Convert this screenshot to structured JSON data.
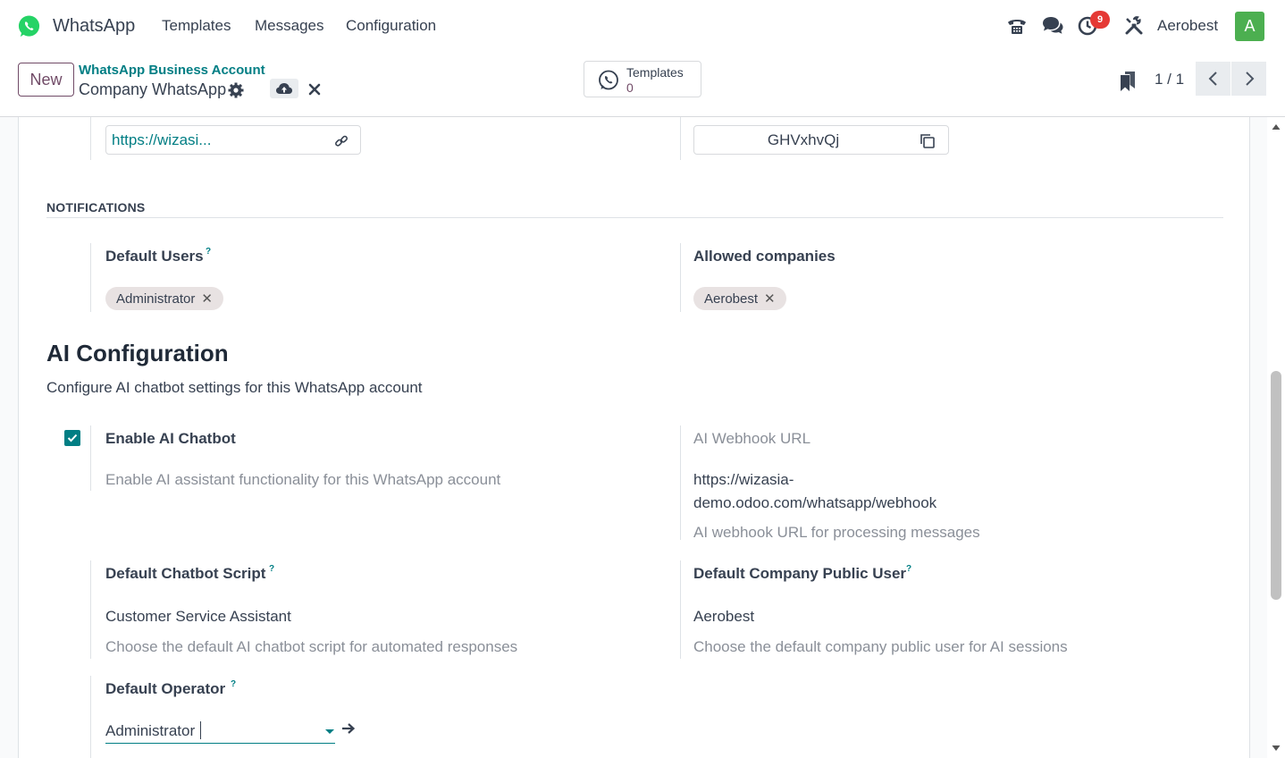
{
  "navbar": {
    "app_name": "WhatsApp",
    "menus": [
      "Templates",
      "Messages",
      "Configuration"
    ],
    "activity_badge": "9",
    "company": "Aerobest",
    "avatar_letter": "A",
    "icons": [
      "phone-icon",
      "chat-icon",
      "activity-clock-icon",
      "tools-icon"
    ]
  },
  "control": {
    "new_label": "New",
    "breadcrumb_parent": "WhatsApp Business Account",
    "breadcrumb_current": "Company WhatsApp",
    "smart_button": {
      "label": "Templates",
      "count": "0"
    },
    "pager": "1 / 1"
  },
  "top_fields": {
    "callback_url": "https://wizasi...",
    "webhook_token": "GHVxhvQj"
  },
  "notifications": {
    "section_title": "NOTIFICATIONS",
    "default_users_label": "Default Users",
    "default_users": [
      "Administrator"
    ],
    "allowed_companies_label": "Allowed companies",
    "allowed_companies": [
      "Aerobest"
    ]
  },
  "ai": {
    "title": "AI Configuration",
    "subtitle": "Configure AI chatbot settings for this WhatsApp account",
    "enable_label": "Enable AI Chatbot",
    "enable_checked": true,
    "enable_help": "Enable AI assistant functionality for this WhatsApp account",
    "webhook_label": "AI Webhook URL",
    "webhook_line1": "https://wizasia-",
    "webhook_line2": "demo.odoo.com/whatsapp/webhook",
    "webhook_help": "AI webhook URL for processing messages",
    "script_label": "Default Chatbot Script",
    "script_value": "Customer Service Assistant",
    "script_help": "Choose the default AI chatbot script for automated responses",
    "public_user_label": "Default Company Public User",
    "public_user_value": "Aerobest",
    "public_user_help": "Choose the default company public user for AI sessions",
    "operator_label": "Default Operator",
    "operator_value": "Administrator",
    "help_marker": "?"
  },
  "colors": {
    "primary": "#714b67",
    "accent": "#017e84",
    "badge": "#e53935",
    "avatar": "#4caf50"
  }
}
